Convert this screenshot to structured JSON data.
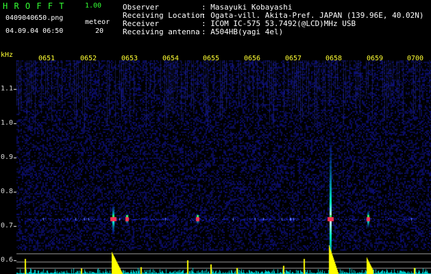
{
  "app": {
    "name": "H R O F F T",
    "version": "1.00",
    "filename": "0409040650.png",
    "datetime": "04.09.04 06:50",
    "counter_label": "meteor",
    "counter_value": "20"
  },
  "info": {
    "observer_label": "Observer",
    "observer_value": ": Masayuki Kobayashi",
    "location_label": "Receiving Location",
    "location_value": ": Ogata-vill. Akita-Pref. JAPAN (139.96E, 40.02N)",
    "receiver_label": "Receiver",
    "receiver_value": ": ICOM IC-575 53.7492(@LCD)MHz USB",
    "antenna_label": "Receiving antenna",
    "antenna_value": ": A504HB(yagi 4el)"
  },
  "axis": {
    "unit": "kHz",
    "time_ticks": [
      "0651",
      "0652",
      "0653",
      "0654",
      "0655",
      "0656",
      "0657",
      "0658",
      "0659",
      "0700"
    ],
    "freq_ticks": [
      "1.1",
      "1.0",
      "0.9",
      "0.8",
      "0.7",
      "0.6"
    ]
  },
  "chart_data": {
    "type": "heatmap",
    "title": "",
    "xlabel": "",
    "ylabel": "kHz",
    "x_ticks": [
      "0651",
      "0652",
      "0653",
      "0654",
      "0655",
      "0656",
      "0657",
      "0658",
      "0659",
      "0700"
    ],
    "y_ticks": [
      1.1,
      1.0,
      0.9,
      0.8,
      0.7,
      0.6
    ],
    "ylim": [
      0.58,
      1.18
    ],
    "carrier_khz": 0.72,
    "meteor_count": 20,
    "detections": [
      {
        "time": "06:52:38",
        "strength": "strong"
      },
      {
        "time": "06:57:55",
        "strength": "strong"
      },
      {
        "time": "06:58:50",
        "strength": "medium"
      },
      {
        "time": "06:54:41",
        "strength": "weak"
      },
      {
        "time": "06:52:58",
        "strength": "weak"
      }
    ]
  },
  "colors": {
    "background": "#000000",
    "noise": "#10135a",
    "carrier": "#2233ff",
    "echo_core": "#ff3355",
    "echo_halo": "#00ffcc",
    "bars": "#ffff00",
    "floor": "#00cccc",
    "title": "#33ff33",
    "text": "#ffffff"
  }
}
